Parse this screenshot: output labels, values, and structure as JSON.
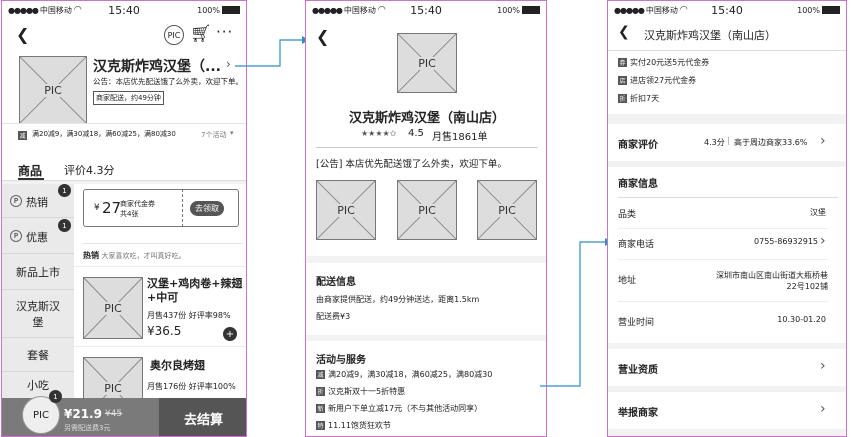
{
  "status": {
    "carrier": "中国移动",
    "time": "15:40",
    "battery": "100%"
  },
  "screen1": {
    "pic_badge": "PIC",
    "store_title": "汉克斯炸鸡汉堡（...",
    "notice": "公告：本店优先配送饿了么外卖，欢迎下单。",
    "delivery_tag": "商家配送，约49分钟",
    "promo": "满20减9，满30减18，满60减25，满80减30",
    "promo_more": "7个活动",
    "tabs": [
      "商品",
      "评价4.3分"
    ],
    "categories": [
      {
        "label": "热销",
        "badge": "1"
      },
      {
        "label": "优惠",
        "badge": "1"
      },
      {
        "label": "新品上市"
      },
      {
        "label": "汉克斯汉堡"
      },
      {
        "label": "套餐"
      },
      {
        "label": "小吃"
      }
    ],
    "coupon": {
      "symbol": "¥",
      "amount": "27",
      "title": "商家代金券",
      "subtitle": "共4张",
      "button": "去领取"
    },
    "hot": {
      "title": "热销",
      "desc": "大家喜欢吃，才叫真好吃。"
    },
    "products": [
      {
        "name": "汉堡+鸡肉卷+辣翅+中可",
        "stats": "月售437份 好评率98%",
        "price": "¥36.5"
      },
      {
        "name": "奥尔良烤翅",
        "stats": "月售176份 好评率100%",
        "price": ""
      }
    ],
    "cart": {
      "badge": "1",
      "price": "¥21.9",
      "original": "¥45",
      "note": "另需配送费3元",
      "checkout": "去结算"
    }
  },
  "screen2": {
    "store_name": "汉克斯炸鸡汉堡（南山店）",
    "rating": "4.5",
    "monthly_sales": "月售1861单",
    "notice": "[公告] 本店优先配送饿了么外卖，欢迎下单。",
    "delivery": {
      "title": "配送信息",
      "line1": "由商家提供配送，约49分钟送达，距离1.5km",
      "line2": "配送费¥3"
    },
    "activities": {
      "title": "活动与服务",
      "items": [
        {
          "icon": "减",
          "text": "满20减9，满30减18，满60减25，满80减30"
        },
        {
          "icon": "折",
          "text": "汉克斯双十一5折特惠"
        },
        {
          "icon": "新",
          "text": "新用户下单立减17元（不与其他活动同享）"
        },
        {
          "icon": "特",
          "text": "11.11饱货狂欢节"
        }
      ]
    }
  },
  "screen3": {
    "title": "汉克斯炸鸡汉堡（南山店）",
    "coupons": [
      {
        "icon": "券",
        "text": "实付20元送5元代金券"
      },
      {
        "icon": "店",
        "text": "进店领27元代金券"
      },
      {
        "icon": "折",
        "text": "折扣7天"
      }
    ],
    "review": {
      "label": "商家评价",
      "score": "4.3分",
      "compare": "高于周边商家33.6%"
    },
    "info": {
      "title": "商家信息",
      "rows": [
        {
          "label": "品类",
          "value": "汉堡"
        },
        {
          "label": "商家电话",
          "value": "0755-86932915"
        },
        {
          "label": "地址",
          "value": "深圳市南山区南山街道大瓶桥巷22号102铺"
        },
        {
          "label": "营业时间",
          "value": "10.30-01.20"
        }
      ]
    },
    "license": "营业资质",
    "report": "举报商家"
  }
}
